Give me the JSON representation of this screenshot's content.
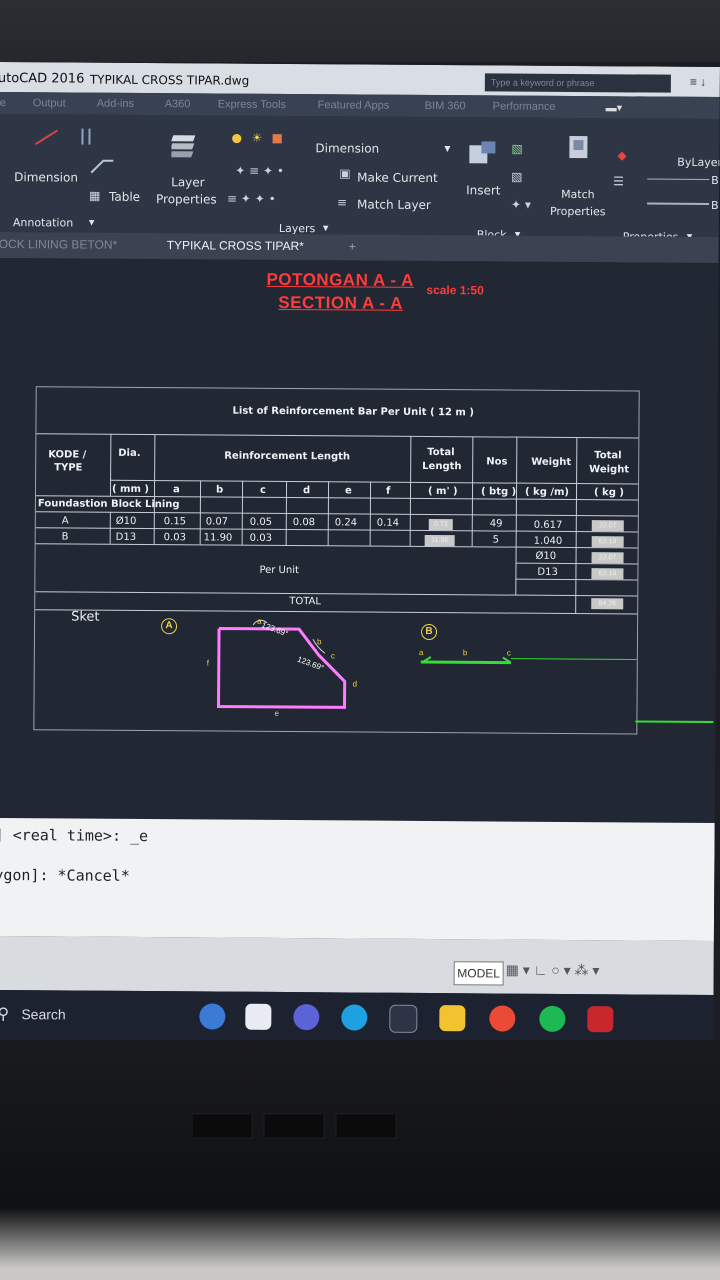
{
  "titlebar": {
    "app": "utoCAD 2016",
    "file": "TYPIKAL CROSS TIPAR.dwg",
    "search_placeholder": "Type a keyword or phrase",
    "controls": "≡  ↓"
  },
  "ribbon_tabs": [
    "e",
    "Output",
    "Add-ins",
    "A360",
    "Express Tools",
    "Featured Apps",
    "BIM 360",
    "Performance"
  ],
  "ribbon": {
    "dimension": "Dimension",
    "table": "Table",
    "annotation": "Annotation",
    "layer": "Layer",
    "properties": "Properties",
    "dimension_dd": "Dimension",
    "make_current": "Make Current",
    "match_layer": "Match Layer",
    "layers": "Layers",
    "insert": "Insert",
    "block": "Block",
    "match": "Match",
    "match_properties": "Properties",
    "properties_panel": "Properties",
    "bylayer": "ByLayer",
    "b1": "B",
    "b2": "B"
  },
  "doc_tabs": [
    "OCK LINING BETON*",
    "TYPIKAL CROSS TIPAR*",
    "+"
  ],
  "drawing": {
    "title1": "POTONGAN A - A",
    "title2": "SECTION A - A",
    "scale": "scale 1:50",
    "table_title": "List of Reinforcement Bar Per Unit ( 12 m )",
    "headers": {
      "kode": "KODE /",
      "type": "TYPE",
      "dia": "Dia.",
      "mm": "( mm )",
      "reinforcement": "Reinforcement Length",
      "cols": [
        "a",
        "b",
        "c",
        "d",
        "e",
        "f"
      ],
      "total": "Total",
      "length": "Length",
      "m": "( m' )",
      "nos": "Nos",
      "btg": "( btg )",
      "weight": "Weight",
      "kgm": "( kg /m)",
      "total2": "Total",
      "weight2": "Weight",
      "kg": "( kg )"
    },
    "group": "Foundastion Block Lining",
    "rows": [
      {
        "type": "A",
        "dia": "Ø10",
        "a": "0.15",
        "b": "0.07",
        "c": "0.05",
        "d": "0.08",
        "e": "0.24",
        "f": "0.14",
        "total": "0.73",
        "nos": "49",
        "weight": "0.617",
        "total_weight": "22.07"
      },
      {
        "type": "B",
        "dia": "D13",
        "a": "0.03",
        "b": "11.90",
        "c": "0.03",
        "d": "",
        "e": "",
        "f": "",
        "total": "11.96",
        "nos": "5",
        "weight": "1.040",
        "total_weight": "62.19"
      }
    ],
    "per_unit": "Per Unit",
    "summary": [
      {
        "label": "Ø10",
        "value": "22.07"
      },
      {
        "label": "D13",
        "value": "62.19"
      }
    ],
    "total_label": "TOTAL",
    "total_value": "84.26",
    "sket": "Sket",
    "mark_a": "A",
    "mark_b": "B",
    "angle1": "123.69°",
    "angle2": "123.69°",
    "seg_labels": [
      "a",
      "b",
      "c",
      "d",
      "e",
      "f"
    ],
    "bar_b_labels": [
      "a",
      "b",
      "c"
    ]
  },
  "command": {
    "line1": "] <real time>: _e",
    "line2": "ygon]: *Cancel*"
  },
  "status": {
    "model": "MODEL"
  },
  "taskbar": {
    "search": "Search"
  },
  "colors": {
    "title_red": "#ff3b3b",
    "bar_magenta": "#ff7dff",
    "bar_green": "#33dd33"
  }
}
